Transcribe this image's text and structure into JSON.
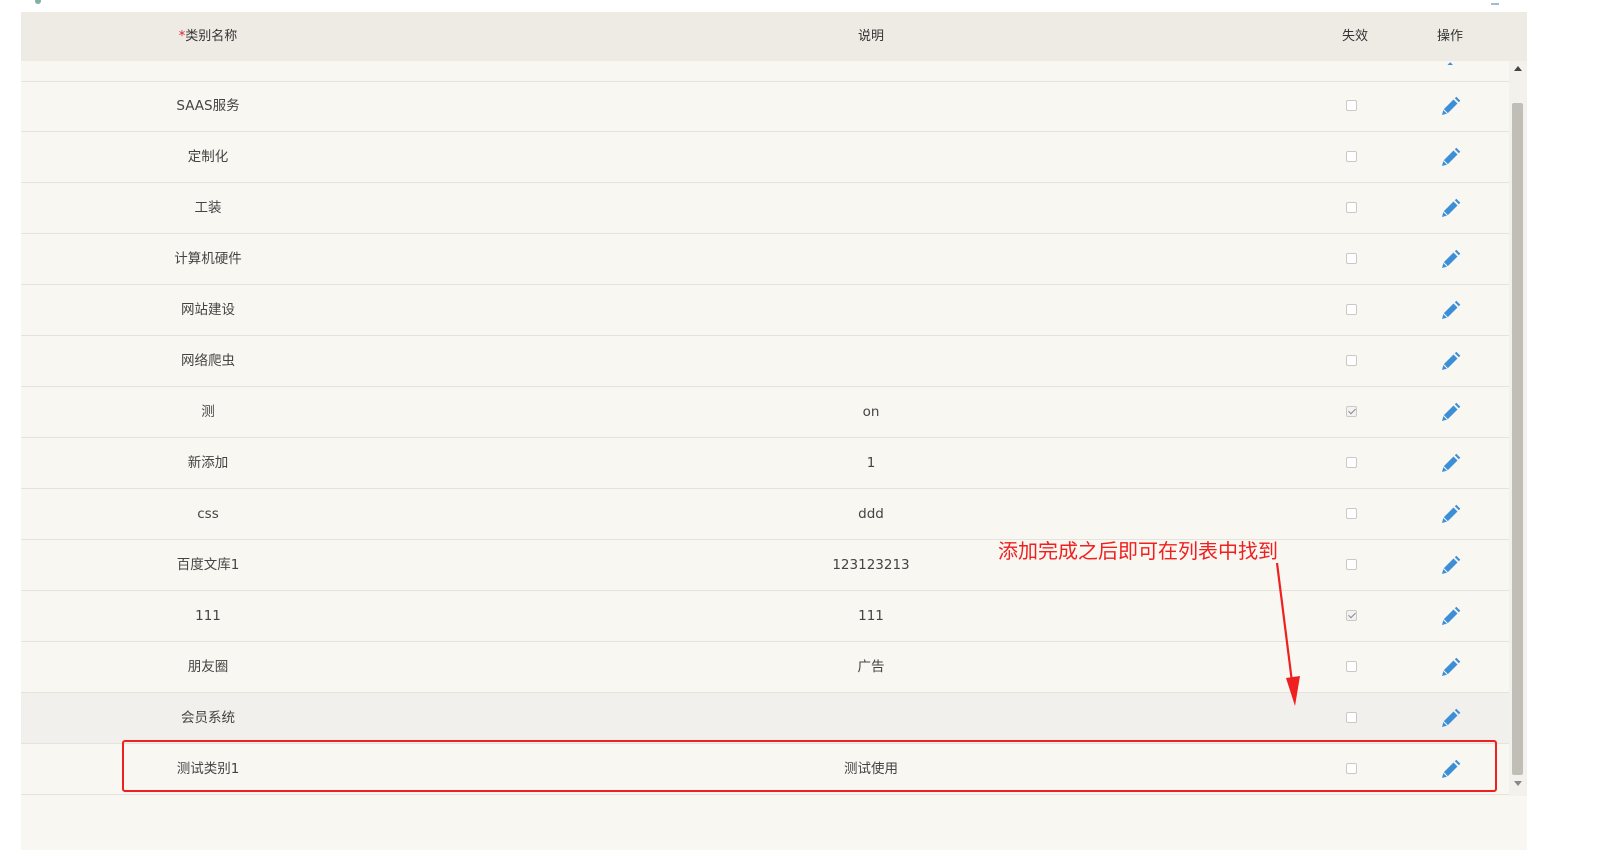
{
  "table": {
    "headers": {
      "required_mark": "*",
      "name": "类别名称",
      "description": "说明",
      "invalid": "失效",
      "action": "操作"
    },
    "rows": [
      {
        "name": "SAAS服务",
        "description": "",
        "invalid": false
      },
      {
        "name": "定制化",
        "description": "",
        "invalid": false
      },
      {
        "name": "工装",
        "description": "",
        "invalid": false
      },
      {
        "name": "计算机硬件",
        "description": "",
        "invalid": false
      },
      {
        "name": "网站建设",
        "description": "",
        "invalid": false
      },
      {
        "name": "网络爬虫",
        "description": "",
        "invalid": false
      },
      {
        "name": "测",
        "description": "on",
        "invalid": true
      },
      {
        "name": "新添加",
        "description": "1",
        "invalid": false
      },
      {
        "name": "css",
        "description": "ddd",
        "invalid": false
      },
      {
        "name": "百度文库1",
        "description": "123123213",
        "invalid": false
      },
      {
        "name": "111",
        "description": "111",
        "invalid": true
      },
      {
        "name": "朋友圈",
        "description": "广告",
        "invalid": false
      },
      {
        "name": "会员系统",
        "description": "",
        "invalid": false
      },
      {
        "name": "测试类别1",
        "description": "测试使用",
        "invalid": false
      }
    ]
  },
  "annotation": {
    "text": "添加完成之后即可在列表中找到",
    "color": "#ee2020"
  },
  "icons": {
    "edit": "pencil-edit-icon"
  },
  "colors": {
    "edit_icon": "#3c8fd6",
    "header_bg": "#eeebe5",
    "row_bg": "#f9f7f2",
    "highlight_border": "#ee2020"
  }
}
